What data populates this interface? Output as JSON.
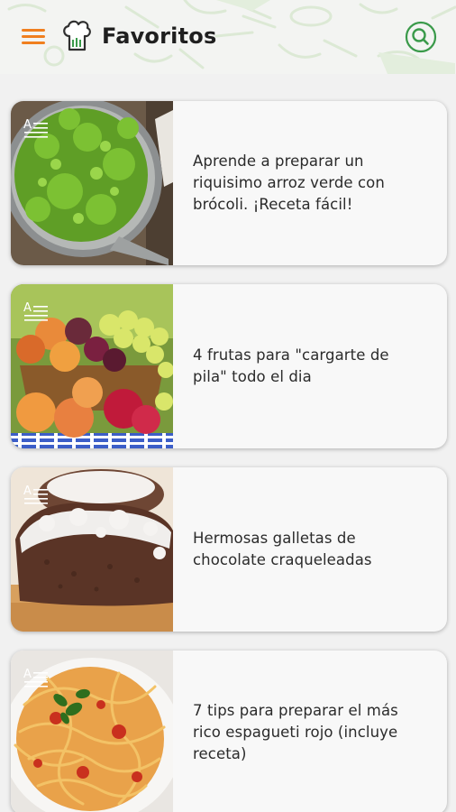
{
  "header": {
    "title": "Favoritos",
    "menu_icon": "hamburger-menu-icon",
    "logo_icon": "chef-hat-icon",
    "search_icon": "search-icon",
    "accent_color": "#f07f1f",
    "search_color": "#3a9a4a"
  },
  "articles": [
    {
      "title": "Aprende a preparar un riquisimo arroz verde con brócoli. ¡Receta fácil!",
      "image": "green-rice-broccoli-photo",
      "type_icon": "article-text-icon"
    },
    {
      "title": "4 frutas para \"cargarte de pila\" todo el dia",
      "image": "fruit-basket-photo",
      "type_icon": "article-text-icon"
    },
    {
      "title": "Hermosas galletas de chocolate craqueleadas",
      "image": "chocolate-crinkle-cookies-photo",
      "type_icon": "article-text-icon"
    },
    {
      "title": "7 tips para preparar el más rico espagueti rojo (incluye receta)",
      "image": "red-spaghetti-photo",
      "type_icon": "article-text-icon"
    }
  ]
}
